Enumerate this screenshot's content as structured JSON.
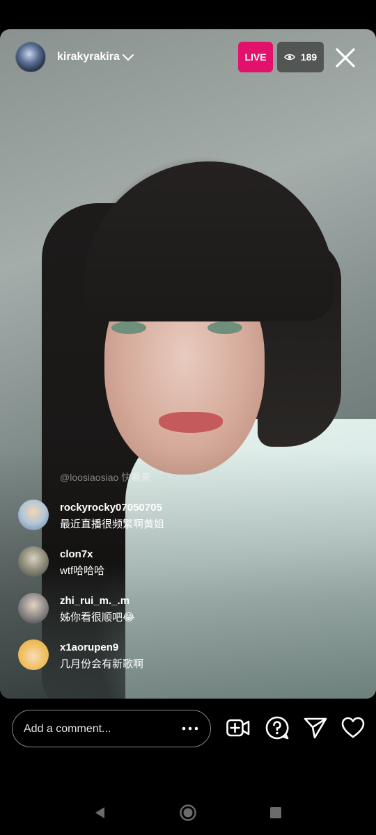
{
  "header": {
    "username": "kirakyrakira",
    "live_label": "LIVE",
    "viewer_count": "189"
  },
  "watermark": "@loosiaosiao 快看来",
  "comments": [
    {
      "user": "rockyrocky07050705",
      "text": "最近直播很频繁啊黄姐"
    },
    {
      "user": "clon7x",
      "text": "wtf哈哈哈"
    },
    {
      "user": "zhi_rui_m._.m",
      "text": "姊你看很顺吧😂"
    },
    {
      "user": "x1aorupen9",
      "text": "几月份会有新歌啊"
    }
  ],
  "composer": {
    "placeholder": "Add a comment..."
  },
  "icons": {
    "chevron": "chevron-down-icon",
    "eye": "eye-icon",
    "close": "close-icon",
    "more": "more-dots-icon",
    "add_video": "add-video-icon",
    "question": "question-icon",
    "send": "send-icon",
    "like": "heart-icon"
  },
  "colors": {
    "live": "#e1116c",
    "background": "#000000"
  }
}
